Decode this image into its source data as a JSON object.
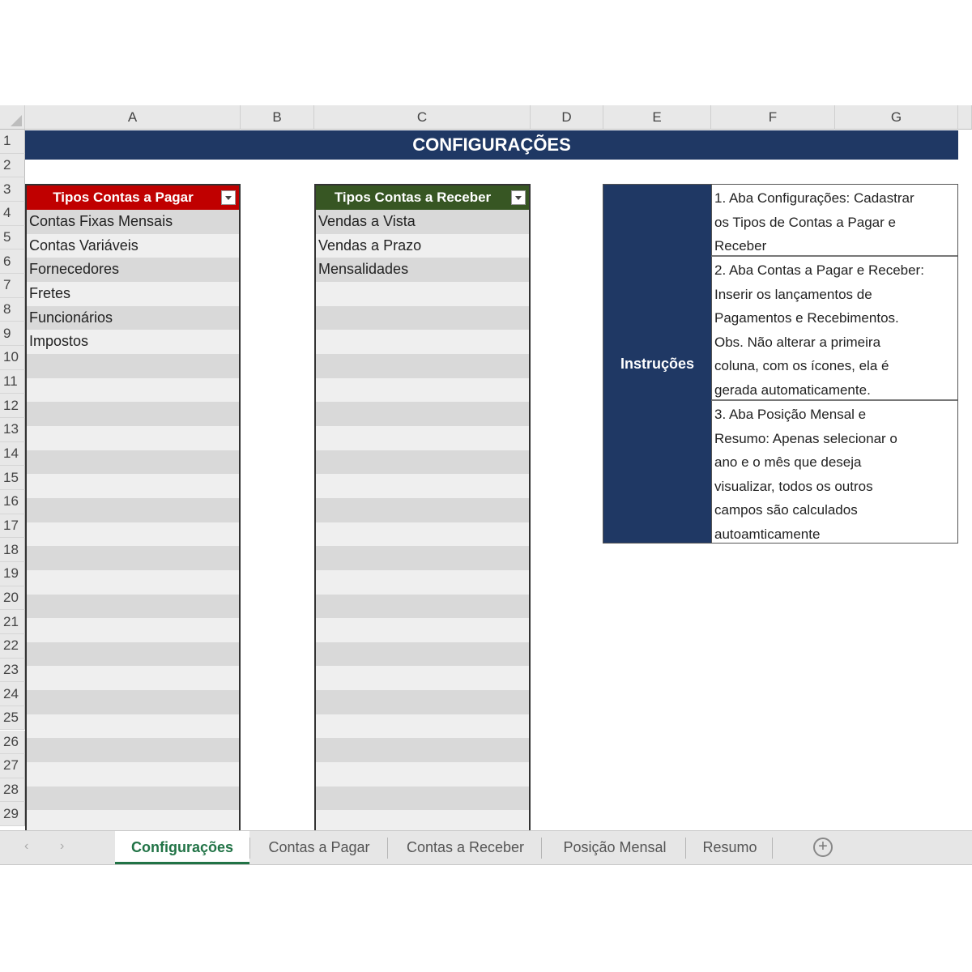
{
  "columns": [
    "A",
    "B",
    "C",
    "D",
    "E",
    "F",
    "G"
  ],
  "rows": [
    "1",
    "2",
    "3",
    "4",
    "5",
    "6",
    "7",
    "8",
    "9",
    "10",
    "11",
    "12",
    "13",
    "14",
    "15",
    "16",
    "17",
    "18",
    "19",
    "20",
    "21",
    "22",
    "23",
    "24",
    "25",
    "26",
    "27",
    "28",
    "29"
  ],
  "banner": {
    "title": "CONFIGURAÇÕES",
    "color": "#1f3864"
  },
  "tables": {
    "pagar": {
      "header": "Tipos Contas a Pagar",
      "header_color": "#c00000",
      "items": [
        "Contas Fixas Mensais",
        "Contas Variáveis",
        "Fornecedores",
        "Fretes",
        "Funcionários",
        "Impostos"
      ]
    },
    "receber": {
      "header": "Tipos Contas a Receber",
      "header_color": "#375623",
      "items": [
        "Vendas a Vista",
        "Vendas a Prazo",
        "Mensalidades"
      ]
    }
  },
  "instructions": {
    "label": "Instruções",
    "items": [
      [
        "1. Aba Configurações: Cadastrar",
        "os Tipos de Contas a Pagar e",
        "Receber"
      ],
      [
        "2. Aba Contas a Pagar e Receber:",
        "Inserir os lançamentos de",
        "Pagamentos e Recebimentos.",
        "Obs. Não alterar a primeira",
        "coluna, com os ícones, ela é",
        "gerada automaticamente."
      ],
      [
        "3. Aba Posição Mensal e",
        "Resumo: Apenas selecionar o",
        "ano e o mês que deseja",
        "visualizar, todos os outros",
        "campos são calculados",
        "autoamticamente"
      ]
    ]
  },
  "sheet_tabs": {
    "nav_prev": "‹",
    "nav_next": "›",
    "tabs": [
      "Configurações",
      "Contas a Pagar",
      "Contas a Receber",
      "Posição Mensal",
      "Resumo"
    ],
    "active_index": 0,
    "add_icon": "plus-circle-icon",
    "accent": "#217346"
  }
}
